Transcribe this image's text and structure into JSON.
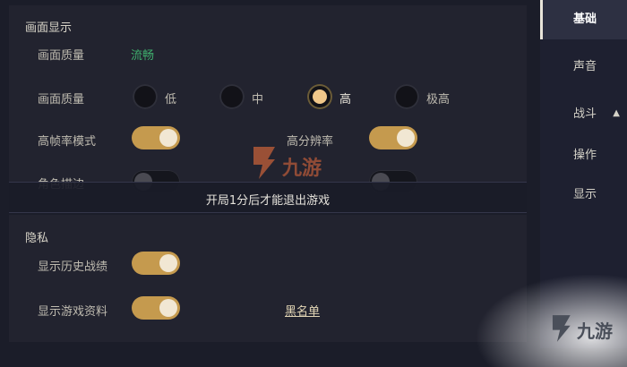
{
  "display": {
    "section_title": "画面显示",
    "quality_label": "画面质量",
    "quality_value": "流畅",
    "quality_label_2": "画面质量",
    "options": [
      "低",
      "中",
      "高",
      "极高"
    ],
    "selected_option": "高",
    "high_fps_label": "高帧率模式",
    "high_fps_on": true,
    "high_res_label": "高分辨率",
    "high_res_on": true,
    "outline_label": "角色描边",
    "outline_on": false,
    "second_toggle_on": false
  },
  "toast": {
    "text": "开局1分后才能退出游戏"
  },
  "privacy": {
    "section_title": "隐私",
    "history_label": "显示历史战绩",
    "history_on": true,
    "profile_label": "显示游戏资料",
    "profile_on": true,
    "blacklist_link": "黑名单"
  },
  "sidebar": {
    "items": [
      {
        "label": "基础",
        "active": true
      },
      {
        "label": "声音",
        "active": false
      },
      {
        "label": "战斗",
        "active": false,
        "icon": "chevron-up-icon"
      },
      {
        "label": "操作",
        "active": false
      },
      {
        "label": "显示",
        "active": false
      }
    ]
  },
  "watermark": {
    "text": "九游"
  },
  "colors": {
    "accent": "#c59a4e",
    "green": "#3fae6d",
    "background": "#1b1d29"
  }
}
